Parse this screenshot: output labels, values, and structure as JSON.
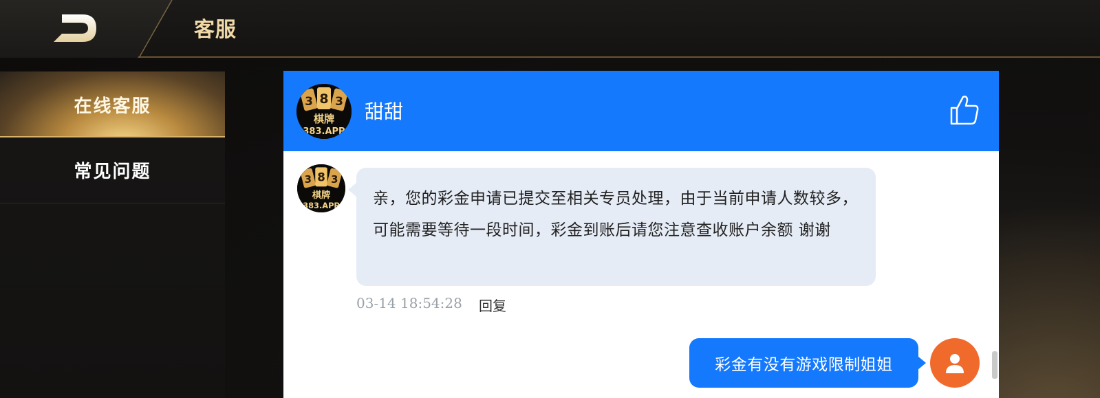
{
  "header": {
    "title": "客服"
  },
  "sidebar": {
    "items": [
      {
        "label": "在线客服",
        "active": true
      },
      {
        "label": "常见问题",
        "active": false
      }
    ]
  },
  "chat": {
    "agent_name": "甜甜",
    "logo_text": {
      "number": "383",
      "subtitle": "棋牌",
      "site": "383.APP"
    },
    "messages": [
      {
        "from": "agent",
        "text": "亲，您的彩金申请已提交至相关专员处理，由于当前申请人数较多，可能需要等待一段时间，彩金到账后请您注意查收账户余额 谢谢",
        "timestamp": "03-14 18:54:28",
        "reply_label": "回复"
      },
      {
        "from": "user",
        "text": "彩金有没有游戏限制姐姐"
      }
    ]
  },
  "colors": {
    "accent_blue": "#1479fd",
    "gold": "#d8b26a",
    "user_avatar": "#f06a2b"
  },
  "icons": {
    "back": "back-arrow-icon",
    "like": "thumbs-up-icon",
    "user": "user-icon"
  }
}
